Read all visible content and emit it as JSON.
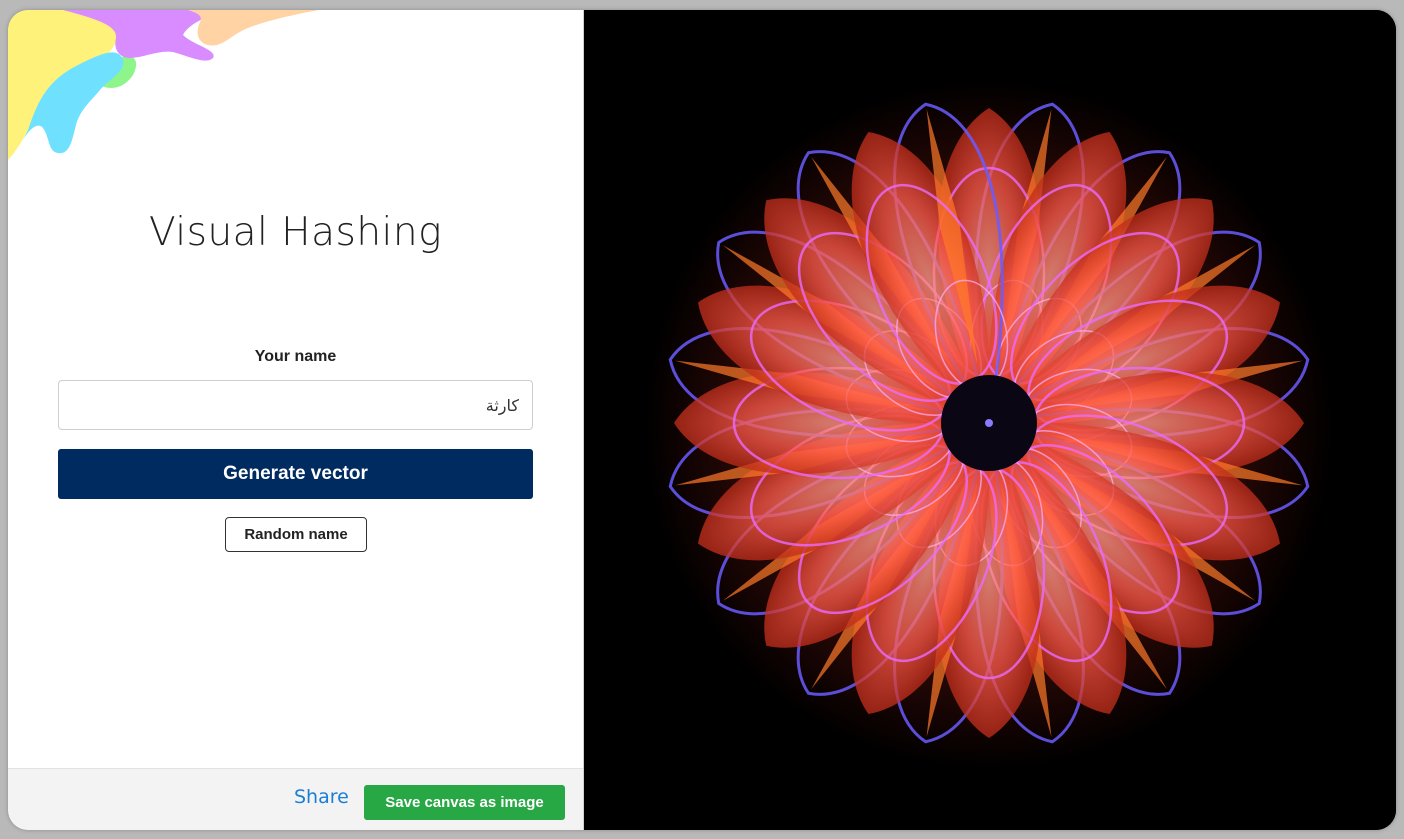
{
  "app": {
    "title": "Visual Hashing"
  },
  "form": {
    "name_label": "Your name",
    "name_value": "كارثة",
    "generate_label": "Generate vector",
    "random_label": "Random name"
  },
  "footer": {
    "share_label": "Share",
    "save_label": "Save canvas as image"
  },
  "colors": {
    "primary": "#002b61",
    "success": "#28a745",
    "link": "#1a7fd4",
    "canvas_background": "#000000",
    "blob_colors": [
      "#fff27a",
      "#6fe1ff",
      "#d98cff",
      "#ffd3a3",
      "#8ef58a"
    ],
    "mandala_colors": [
      "#ff5a4a",
      "#ff7a2a",
      "#e86bff",
      "#6a5cff"
    ]
  }
}
